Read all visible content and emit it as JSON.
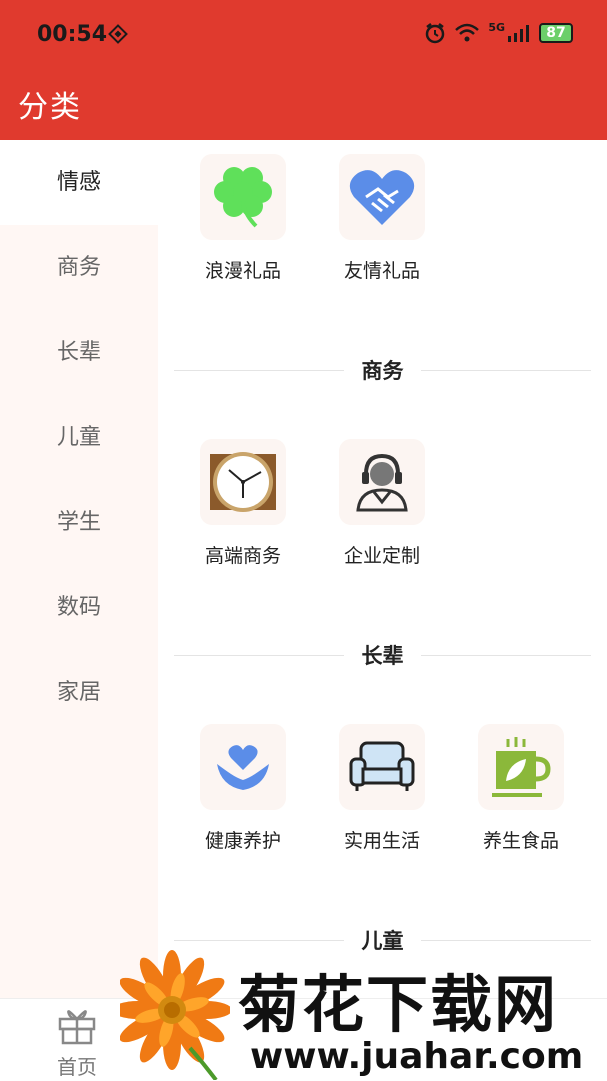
{
  "status": {
    "time": "00:54",
    "network": "5G",
    "battery": "87"
  },
  "appbar": {
    "title": "分类"
  },
  "sidebar": {
    "items": [
      {
        "label": "情感",
        "active": true
      },
      {
        "label": "商务"
      },
      {
        "label": "长辈"
      },
      {
        "label": "儿童"
      },
      {
        "label": "学生"
      },
      {
        "label": "数码"
      },
      {
        "label": "家居"
      }
    ]
  },
  "sections": [
    {
      "title": "",
      "items": [
        {
          "label": "浪漫礼品",
          "icon": "clover-icon"
        },
        {
          "label": "友情礼品",
          "icon": "handshake-heart-icon"
        }
      ]
    },
    {
      "title": "商务",
      "items": [
        {
          "label": "高端商务",
          "icon": "clock-icon"
        },
        {
          "label": "企业定制",
          "icon": "headset-person-icon"
        }
      ]
    },
    {
      "title": "长辈",
      "items": [
        {
          "label": "健康养护",
          "icon": "heart-hands-icon"
        },
        {
          "label": "实用生活",
          "icon": "armchair-icon"
        },
        {
          "label": "养生食品",
          "icon": "tea-cup-icon"
        }
      ]
    },
    {
      "title": "儿童"
    }
  ],
  "bottom_nav": {
    "home_label": "首页"
  },
  "watermark": {
    "title": "菊花下载网",
    "url": "www.juahar.com"
  },
  "colors": {
    "primary": "#e03a2e",
    "sidebar_bg": "#fff7f4",
    "tile_bg": "#fcf5f2"
  }
}
